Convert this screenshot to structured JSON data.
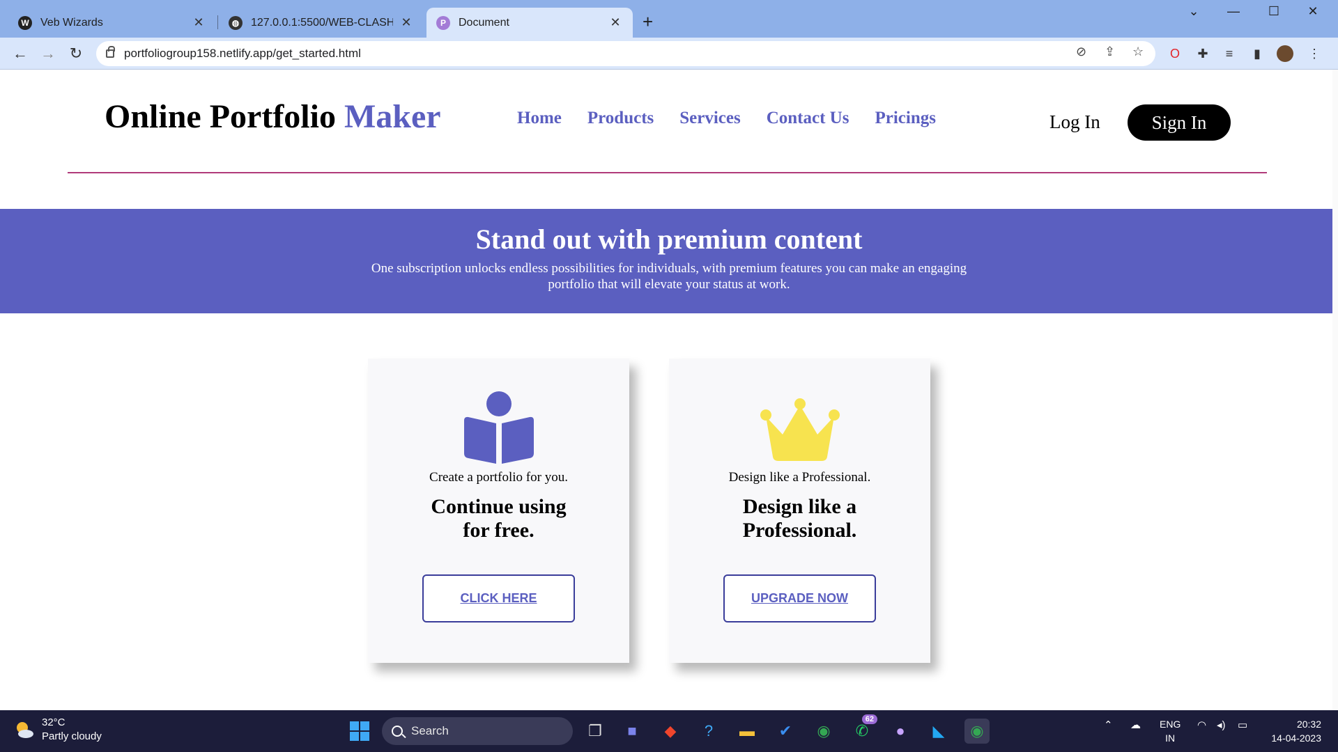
{
  "browser": {
    "tabs": [
      {
        "title": "Veb Wizards",
        "favicon": "wordpress-icon"
      },
      {
        "title": "127.0.0.1:5500/WEB-CLASH/inde",
        "favicon": "globe-icon"
      },
      {
        "title": "Document",
        "favicon": "portfolio-icon",
        "active": true
      }
    ],
    "url": "portfoliogroup158.netlify.app/get_started.html"
  },
  "site": {
    "brand_main": "Online Portfolio",
    "brand_accent": "Maker",
    "nav": [
      "Home",
      "Products",
      "Services",
      "Contact Us",
      "Pricings"
    ],
    "login": "Log In",
    "signin": "Sign In"
  },
  "banner": {
    "title": "Stand out with premium content",
    "text": "One subscription unlocks endless possibilities for individuals, with premium features you can make an engaging portfolio that will elevate your status at work."
  },
  "cards": [
    {
      "icon": "book-reader-icon",
      "subtitle": "Create a portfolio for you.",
      "title": "Continue using for free.",
      "button": "CLICK HERE"
    },
    {
      "icon": "crown-icon",
      "subtitle": "Design like a Professional.",
      "title": "Design like a Professional.",
      "button": "UPGRADE NOW"
    }
  ],
  "taskbar": {
    "temperature": "32°C",
    "weather": "Partly cloudy",
    "search": "Search",
    "whatsapp_badge": "62",
    "lang_top": "ENG",
    "lang_bottom": "IN",
    "time": "20:32",
    "date": "14-04-2023"
  },
  "colors": {
    "accent": "#5b5fc0",
    "tabstrip": "#8eb0e8",
    "toolbar": "#d9e6fb",
    "crown": "#f7e34f",
    "divider": "#b03a7a",
    "taskbar": "#1c1d3a"
  }
}
